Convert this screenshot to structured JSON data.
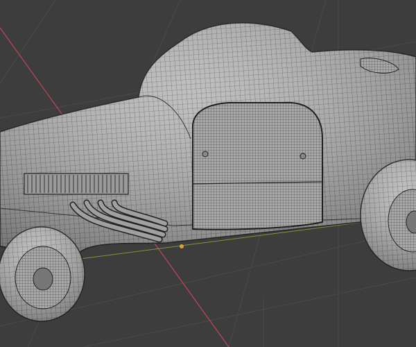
{
  "viewport": {
    "mode": "3d-viewport-wireframe-overlay",
    "colors": {
      "background": "#3d3d3d",
      "grid": "#4a4a4a",
      "x_axis": "#c0465a",
      "y_axis": "#7a9a3a",
      "mesh_fill": "#b4b4b4",
      "mesh_wire": "#2e2e2e"
    }
  }
}
